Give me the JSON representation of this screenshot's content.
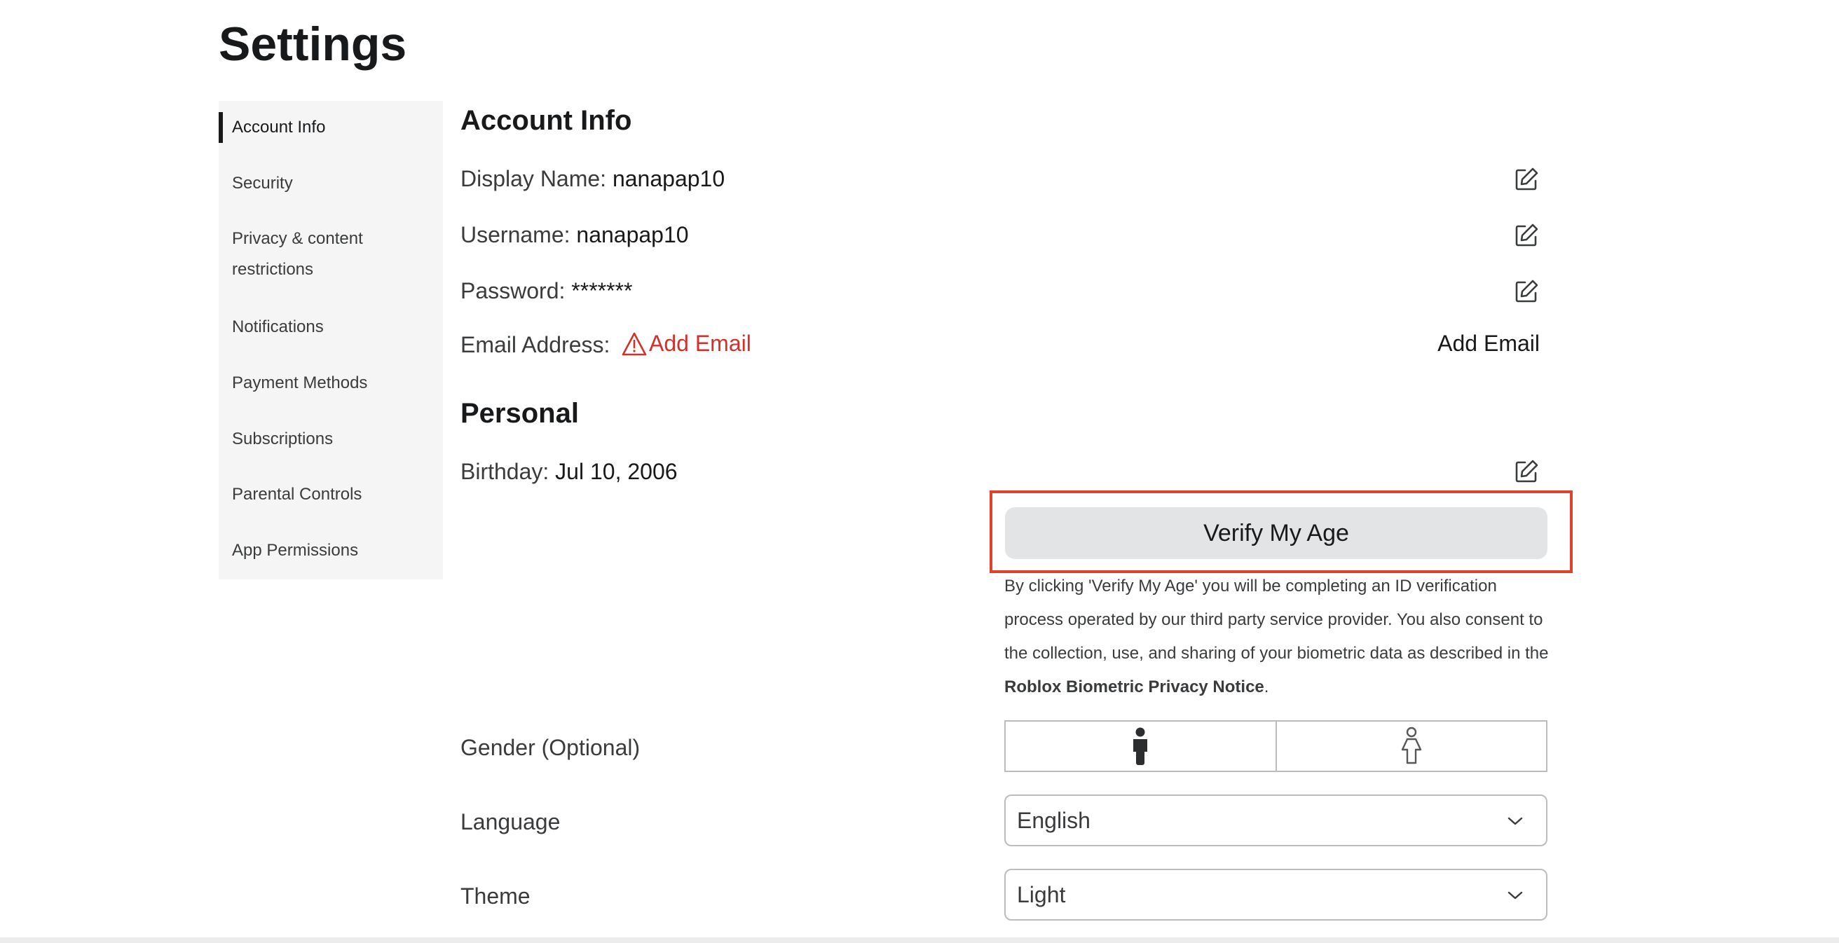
{
  "page_title": "Settings",
  "sidebar": {
    "items": [
      {
        "label": "Account Info",
        "active": true
      },
      {
        "label": "Security"
      },
      {
        "label": "Privacy & content",
        "label2": "restrictions"
      },
      {
        "label": "Notifications"
      },
      {
        "label": "Payment Methods"
      },
      {
        "label": "Subscriptions"
      },
      {
        "label": "Parental Controls"
      },
      {
        "label": "App Permissions"
      }
    ]
  },
  "account_info": {
    "heading": "Account Info",
    "display_name_label": "Display Name:",
    "display_name_value": "nanapap10",
    "username_label": "Username:",
    "username_value": "nanapap10",
    "password_label": "Password:",
    "password_value": "*******",
    "email_label": "Email Address:",
    "email_warning_link": "Add Email",
    "email_action": "Add Email"
  },
  "personal": {
    "heading": "Personal",
    "birthday_label": "Birthday:",
    "birthday_value": "Jul 10, 2006",
    "verify_button": "Verify My Age",
    "verify_note": "By clicking 'Verify My Age' you will be completing an ID verification process operated by our third party service provider. You also consent to the collection, use, and sharing of your biometric data as described in the ",
    "verify_note_link": "Roblox Biometric Privacy Notice",
    "verify_note_end": ".",
    "gender_label": "Gender (Optional)",
    "language_label": "Language",
    "language_value": "English",
    "theme_label": "Theme",
    "theme_value": "Light"
  },
  "colors": {
    "warning": "#d2302a",
    "highlight": "#e0432c",
    "active_marker": "#18191b"
  }
}
